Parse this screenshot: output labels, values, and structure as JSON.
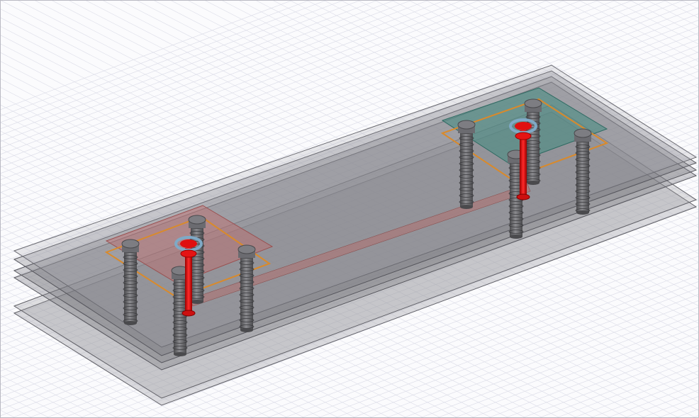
{
  "scene": {
    "view": "isometric",
    "grid": true,
    "background_color": "#fbfbfd",
    "grid_color": "#dcdde8",
    "substrate_layer_color": "#8a8a8e",
    "substrate_layer_count": 6,
    "via_color": "#6b6b6e",
    "feed_pin_color": "#e01010",
    "feed_ring_color": "#7fa9c6",
    "trace_color": "#d98a2b",
    "stripline_color": "#b07070",
    "ports": [
      {
        "id": "port-1",
        "color": "#c26a6a"
      },
      {
        "id": "port-2",
        "color": "#3f8a80"
      }
    ]
  }
}
